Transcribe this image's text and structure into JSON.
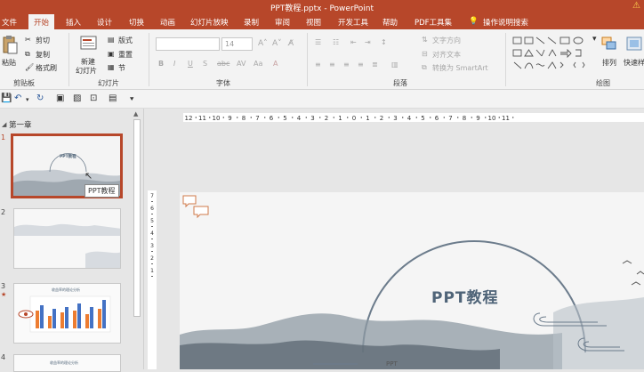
{
  "window": {
    "title": "PPT教程.pptx - PowerPoint"
  },
  "tabs": [
    {
      "label": "文件"
    },
    {
      "label": "开始"
    },
    {
      "label": "插入"
    },
    {
      "label": "设计"
    },
    {
      "label": "切换"
    },
    {
      "label": "动画"
    },
    {
      "label": "幻灯片放映"
    },
    {
      "label": "录制"
    },
    {
      "label": "审阅"
    },
    {
      "label": "视图"
    },
    {
      "label": "开发工具"
    },
    {
      "label": "帮助"
    },
    {
      "label": "PDF工具集"
    },
    {
      "label": "操作说明搜索"
    }
  ],
  "ribbon": {
    "clipboard": {
      "paste": "粘贴",
      "cut": "剪切",
      "copy": "复制",
      "format_painter": "格式刷",
      "label": "剪贴板"
    },
    "slides": {
      "new_slide_1": "新建",
      "new_slide_2": "幻灯片",
      "layout": "版式",
      "reset": "重置",
      "section": "节",
      "label": "幻灯片"
    },
    "font": {
      "font_size": "14",
      "label": "字体"
    },
    "paragraph": {
      "text_direction": "文字方向",
      "align_text": "对齐文本",
      "smartart": "转换为 SmartArt",
      "label": "段落"
    },
    "drawing": {
      "arrange": "排列",
      "quick_styles": "快速样",
      "label": "绘图"
    }
  },
  "thumbnails": {
    "section": "第一章",
    "slides": [
      {
        "num": "1",
        "title": "PPT教程"
      },
      {
        "num": "2"
      },
      {
        "num": "3",
        "title": "收益率的理论分析"
      },
      {
        "num": "4",
        "title": "收益率的理论分析"
      }
    ],
    "tooltip": "PPT教程"
  },
  "ruler": {
    "h_ticks": [
      "12",
      "11",
      "10",
      "9",
      "8",
      "7",
      "6",
      "5",
      "4",
      "3",
      "2",
      "1",
      "0",
      "1",
      "2",
      "3",
      "4",
      "5",
      "6",
      "7",
      "8",
      "9",
      "10",
      "11"
    ],
    "v_ticks": [
      "7",
      "6",
      "5",
      "4",
      "3",
      "2",
      "1"
    ]
  },
  "slide": {
    "title": "PPT教程",
    "subtitle": "PPT"
  },
  "colors": {
    "accent": "#b7472a",
    "slide_title": "#4f6478"
  }
}
